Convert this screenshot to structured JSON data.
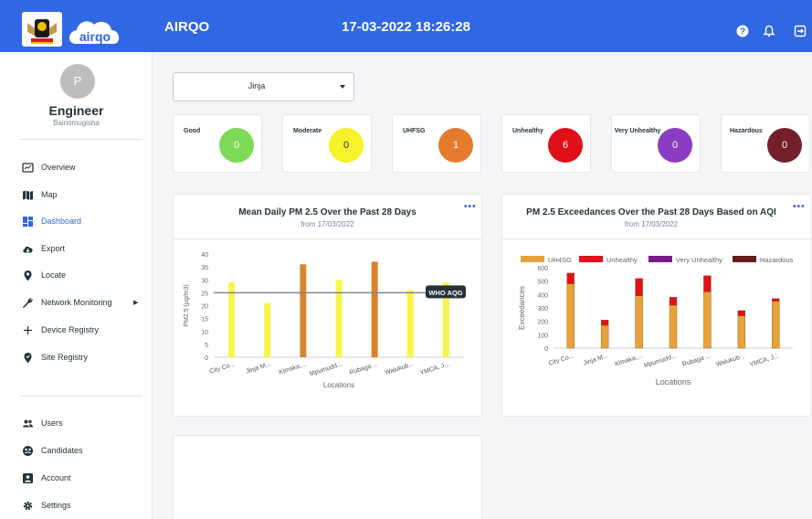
{
  "header": {
    "brand": "airqo",
    "app_title": "AIRQO",
    "datetime": "17-03-2022 18:26:28"
  },
  "user": {
    "avatar_letter": "P",
    "role": "Engineer",
    "name": "Bainomugisha"
  },
  "nav": {
    "main": [
      {
        "label": "Overview",
        "icon": "overview-icon"
      },
      {
        "label": "Map",
        "icon": "map-icon"
      },
      {
        "label": "Dashboard",
        "icon": "dashboard-icon",
        "active": true
      },
      {
        "label": "Export",
        "icon": "cloud-download-icon"
      },
      {
        "label": "Locate",
        "icon": "location-pin-icon"
      },
      {
        "label": "Network Monitoring",
        "icon": "wrench-icon"
      },
      {
        "label": "Device Registry",
        "icon": "plus-icon"
      },
      {
        "label": "Site Registry",
        "icon": "site-pin-icon"
      }
    ],
    "secondary": [
      {
        "label": "Users",
        "icon": "users-icon"
      },
      {
        "label": "Candidates",
        "icon": "candidates-icon"
      },
      {
        "label": "Account",
        "icon": "account-icon"
      },
      {
        "label": "Settings",
        "icon": "settings-icon"
      }
    ]
  },
  "location_select": {
    "value": "Jinja"
  },
  "aqi_cards": [
    {
      "label": "Good",
      "count": "0",
      "color": "#7ed957",
      "text_color": "#ffffff"
    },
    {
      "label": "Moderate",
      "count": "0",
      "color": "#f7f22a",
      "text_color": "#263238"
    },
    {
      "label": "UHFSG",
      "count": "1",
      "color": "#e47c2e",
      "text_color": "#ffffff"
    },
    {
      "label": "Unhealthy",
      "count": "6",
      "color": "#e0101a",
      "text_color": "#ffffff"
    },
    {
      "label": "Very Unhealthy",
      "count": "0",
      "color": "#8a3cc4",
      "text_color": "#ffffff"
    },
    {
      "label": "Hazardous",
      "count": "0",
      "color": "#73202a",
      "text_color": "#ffffff"
    }
  ],
  "pm25_card": {
    "title": "Mean Daily PM 2.5 Over the Past 28 Days",
    "subtitle": "from 17/03/2022",
    "menu": "•••"
  },
  "exceed_card": {
    "title": "PM 2.5 Exceedances Over the Past 28 Days Based on AQI",
    "subtitle": "from 17/03/2022",
    "menu": "•••"
  },
  "chart_data": [
    {
      "type": "bar",
      "categories": [
        "City Co...",
        "Jinja M...",
        "Kimaka,...",
        "Mpumudd...",
        "Rubaga ...",
        "Walukub...",
        "YMCA, J..."
      ],
      "values": [
        29,
        21,
        36,
        30,
        37,
        26,
        29
      ],
      "bar_colors": [
        "#f7f54a",
        "#f7f54a",
        "#d8842a",
        "#f7f54a",
        "#d8842a",
        "#f7f54a",
        "#f7f54a"
      ],
      "xlabel": "Locations",
      "ylabel": "PM2.5 (µg/m3)",
      "ylim": [
        0,
        40
      ],
      "yticks": [
        0,
        5,
        10,
        15,
        20,
        25,
        30,
        35,
        40
      ],
      "reference_line": {
        "value": 25,
        "label": "WHO AQG"
      },
      "grid": false
    },
    {
      "type": "bar",
      "stacked": true,
      "categories": [
        "City Co...",
        "Jinja M...",
        "Kimaka,...",
        "Mpumudd...",
        "Rubaga ...",
        "Walukub...",
        "YMCA, J..."
      ],
      "series": [
        {
          "name": "UH4SG",
          "color": "#e8a23a",
          "values": [
            480,
            170,
            390,
            320,
            420,
            240,
            350
          ]
        },
        {
          "name": "Unhealthy",
          "color": "#e0101a",
          "values": [
            80,
            40,
            130,
            60,
            120,
            40,
            20
          ]
        },
        {
          "name": "Very Unhealthy",
          "color": "#7a1a8c",
          "values": [
            0,
            0,
            0,
            0,
            0,
            0,
            0
          ]
        },
        {
          "name": "Hazardous",
          "color": "#6b1a1a",
          "values": [
            0,
            0,
            0,
            0,
            0,
            0,
            0
          ]
        }
      ],
      "xlabel": "Locations",
      "ylabel": "Exceedances",
      "ylim": [
        0,
        600
      ],
      "yticks": [
        0,
        100,
        200,
        300,
        400,
        500,
        600
      ],
      "legend": "top",
      "grid": false
    }
  ]
}
